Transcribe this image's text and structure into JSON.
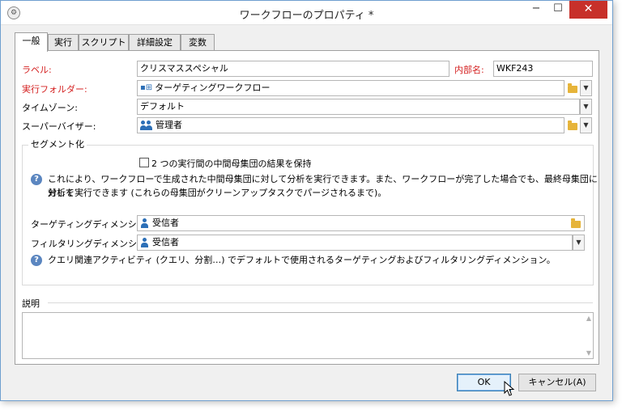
{
  "window": {
    "title": "ワークフローのプロパティ *",
    "min_glyph": "−",
    "max_glyph": "☐",
    "close_glyph": "✕"
  },
  "tabs": [
    {
      "label": "一般",
      "active": true
    },
    {
      "label": "実行",
      "active": false
    },
    {
      "label": "スクリプト",
      "active": false
    },
    {
      "label": "詳細設定",
      "active": false
    },
    {
      "label": "変数",
      "active": false
    }
  ],
  "general": {
    "label_label": "ラベル:",
    "label_value": "クリスマススペシャル",
    "internal_name_label": "内部名:",
    "internal_name_value": "WKF243",
    "exec_folder_label": "実行フォルダー:",
    "exec_folder_value": "ターゲティングワークフロー",
    "timezone_label": "タイムゾーン:",
    "timezone_value": "デフォルト",
    "supervisor_label": "スーパーバイザー:",
    "supervisor_value": "管理者"
  },
  "segmentation": {
    "title": "セグメント化",
    "keep_results_label": "2 つの実行間の中間母集団の結果を保持",
    "keep_results_checked": false,
    "help_line1": "これにより、ワークフローで生成された中間母集団に対して分析を実行できます。また、ワークフローが完了した場合でも、最終母集団に対して",
    "help_line2": "分析を実行できます (これらの母集団がクリーンアップタスクでパージされるまで)。",
    "targeting_dim_label": "ターゲティングディメンション:",
    "targeting_dim_value": "受信者",
    "filtering_dim_label": "フィルタリングディメンション:",
    "filtering_dim_value": "受信者",
    "help2": "クエリ関連アクティビティ (クエリ、分割…) でデフォルトで使用されるターゲティングおよびフィルタリングディメンション。"
  },
  "description": {
    "label": "説明",
    "value": ""
  },
  "buttons": {
    "ok": "OK",
    "cancel": "キャンセル(A)"
  },
  "icons": {
    "app": "workflow-app-icon",
    "folder": "folder-icon",
    "dropdown": "chevron-down-icon",
    "person": "person-icon",
    "group": "group-icon",
    "help": "help-icon"
  }
}
